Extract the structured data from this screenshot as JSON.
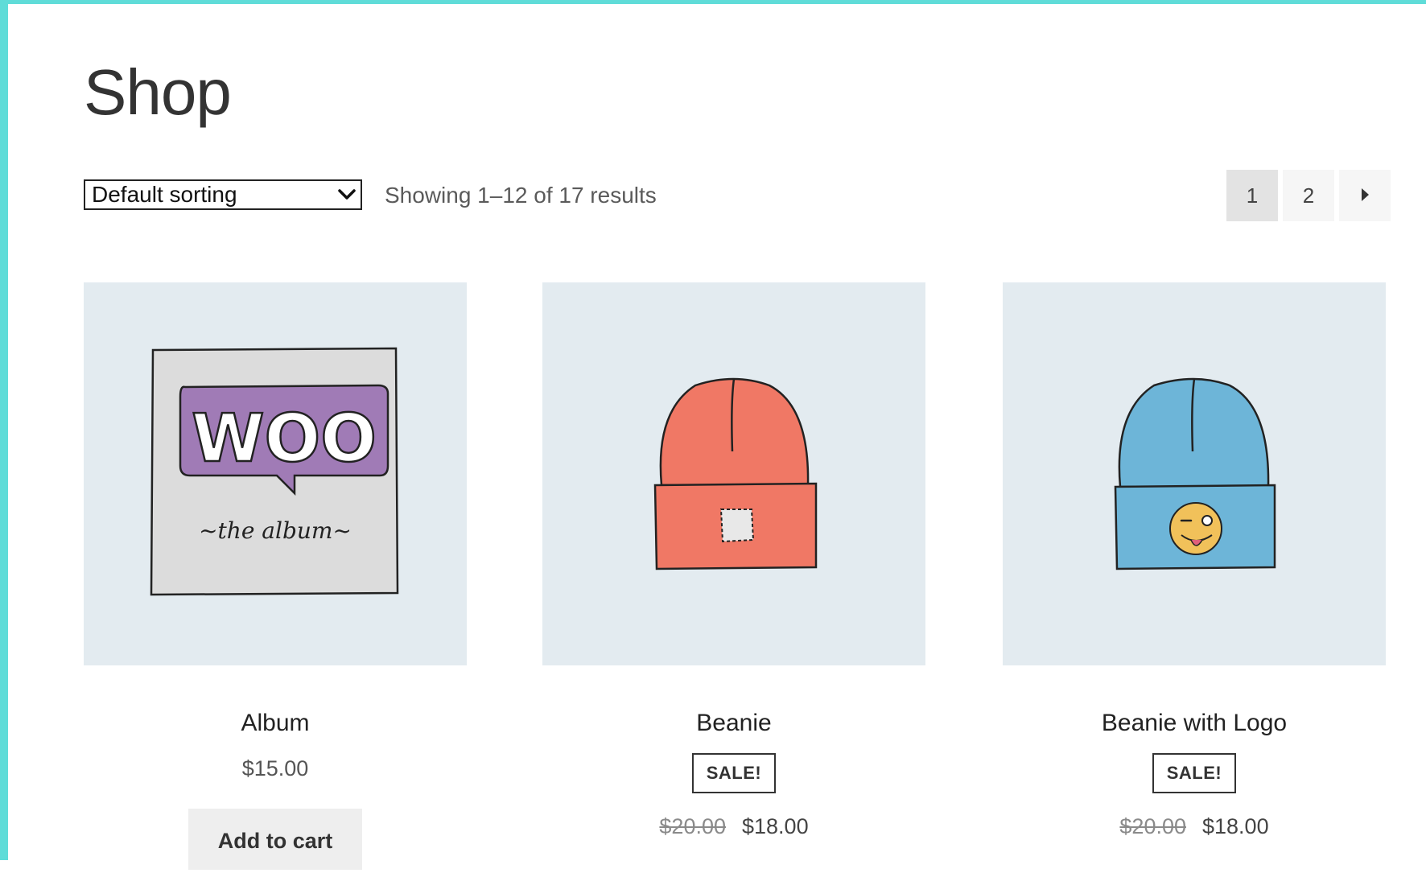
{
  "page": {
    "title": "Shop"
  },
  "toolbar": {
    "sort_value": "Default sorting",
    "result_count": "Showing 1–12 of 17 results"
  },
  "pagination": {
    "pages": [
      "1",
      "2"
    ],
    "current": "1",
    "next_icon": "caret-right-icon"
  },
  "colors": {
    "frame_border": "#5fdcd8",
    "image_bg": "#e3ebf0"
  },
  "products": [
    {
      "name": "Album",
      "price": "$15.00",
      "button": "Add to cart",
      "image_icon": "album-cover-icon",
      "image_text_main": "WOO",
      "image_text_sub": "~the album~"
    },
    {
      "name": "Beanie",
      "badge": "SALE!",
      "old_price": "$20.00",
      "price": "$18.00",
      "image_icon": "orange-beanie-icon"
    },
    {
      "name": "Beanie with Logo",
      "badge": "SALE!",
      "old_price": "$20.00",
      "price": "$18.00",
      "image_icon": "blue-beanie-logo-icon"
    }
  ]
}
